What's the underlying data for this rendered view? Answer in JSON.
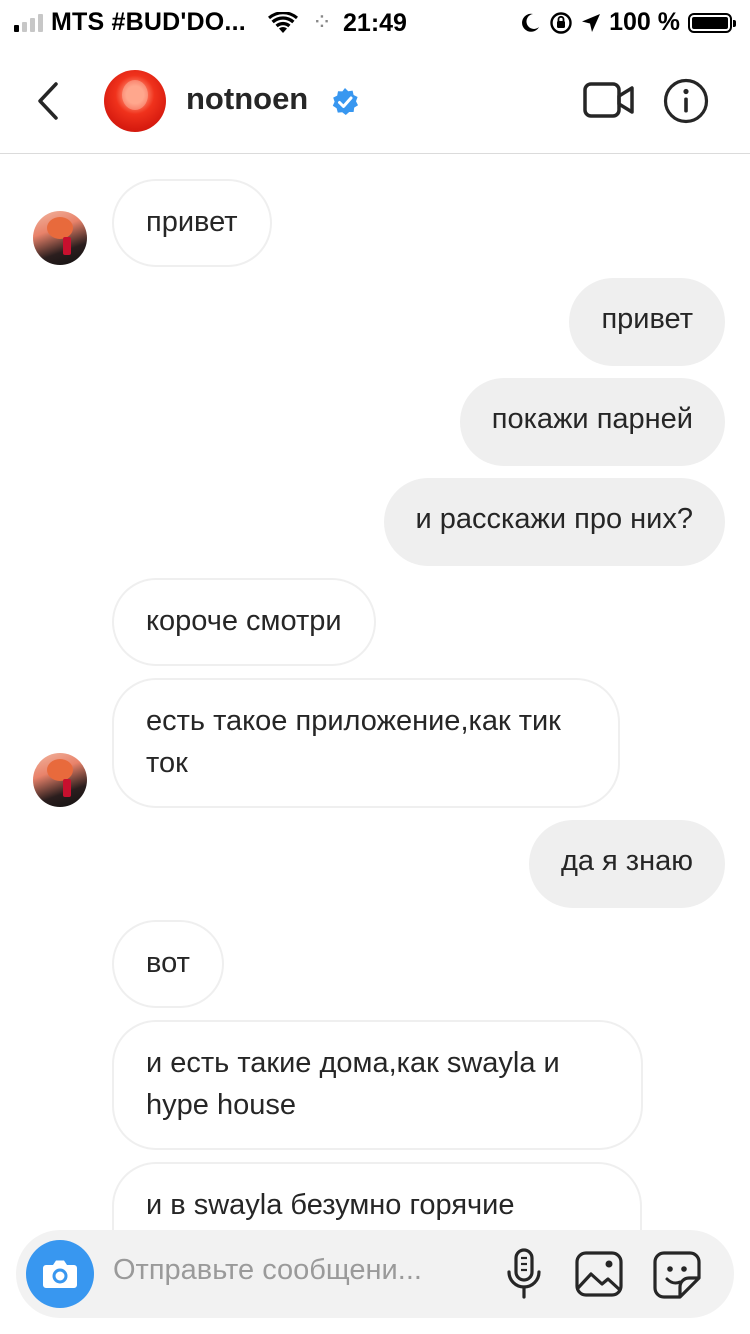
{
  "status_bar": {
    "carrier": "MTS #BUD'DO...",
    "time": "21:49",
    "battery": "100 %"
  },
  "header": {
    "username": "notnoen",
    "verified": true,
    "icons": [
      "back-arrow-icon",
      "video-call-icon",
      "info-icon"
    ]
  },
  "messages": [
    {
      "direction": "in",
      "text": "привет"
    },
    {
      "direction": "out",
      "text": "привет"
    },
    {
      "direction": "out",
      "text": "покажи парней"
    },
    {
      "direction": "out",
      "text": "и расскажи про них?"
    },
    {
      "direction": "in",
      "text": "короче смотри"
    },
    {
      "direction": "in",
      "text": "есть такое приложение,как тик ток"
    },
    {
      "direction": "out",
      "text": "да я знаю"
    },
    {
      "direction": "in",
      "text": "вот"
    },
    {
      "direction": "in",
      "text": "и есть такие дома,как swayla и hype house"
    },
    {
      "direction": "in",
      "text": "и в swayla безумно горячие"
    }
  ],
  "composer": {
    "placeholder": "Отправьте сообщени...",
    "icons": [
      "camera-icon",
      "microphone-icon",
      "gallery-icon",
      "sticker-icon"
    ]
  },
  "colors": {
    "accent_blue": "#3897f0",
    "incoming_bubble_border": "#efefef",
    "outgoing_bubble": "#efefef"
  }
}
